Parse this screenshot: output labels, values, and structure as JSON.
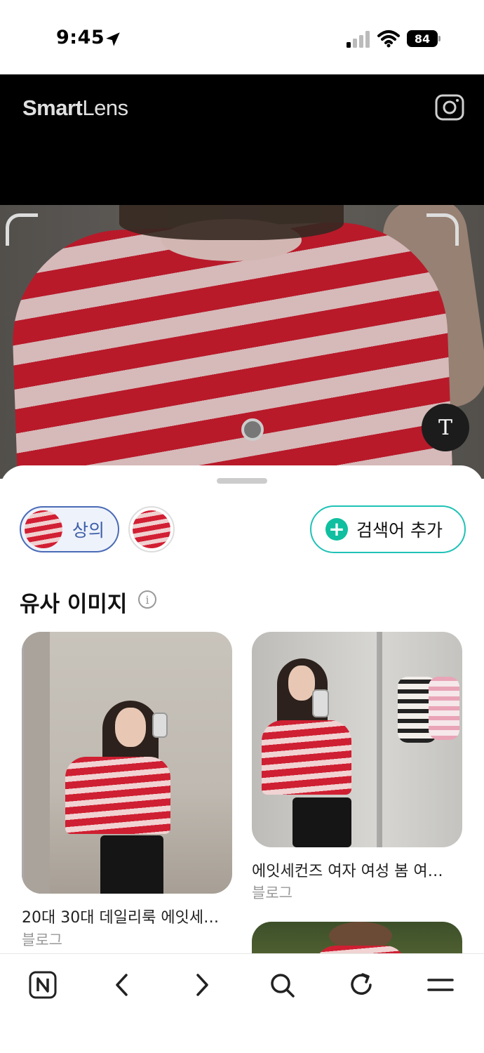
{
  "status_bar": {
    "time": "9:45",
    "battery": "84"
  },
  "header": {
    "logo_bold": "Smart",
    "logo_light": "Lens"
  },
  "camera": {
    "text_button": "T"
  },
  "filters": {
    "selected_chip_label": "상의",
    "add_query_label": "검색어 추가",
    "add_icon": "+"
  },
  "section": {
    "title": "유사 이미지",
    "info_icon": "i"
  },
  "results": [
    {
      "title": "20대 30대 데일리룩 에잇세…",
      "source": "블로그"
    },
    {
      "title": "에잇세컨즈 여자 여성 봄 여…",
      "source": "블로그"
    }
  ],
  "bottom_nav": {
    "home_icon_letter": "N",
    "icons": [
      "naver-home-icon",
      "back-icon",
      "forward-icon",
      "search-icon",
      "refresh-icon",
      "menu-icon"
    ]
  },
  "colors": {
    "accent_blue": "#3d5fa8",
    "accent_teal": "#1fc2b6",
    "plus_green": "#0fbf9f",
    "stripe_red": "#c81d2e"
  }
}
